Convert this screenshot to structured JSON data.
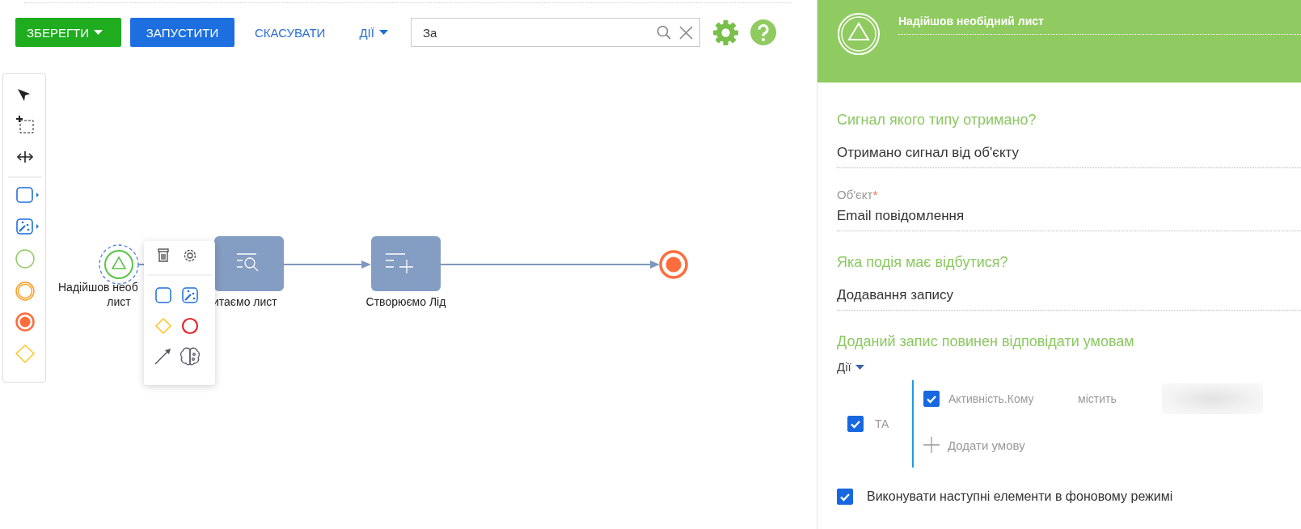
{
  "toolbar": {
    "buttons": [
      {
        "label": "ЗБЕРЕГТИ",
        "kind": "save"
      },
      {
        "label": "ЗАПУСТИТИ",
        "kind": "run"
      },
      {
        "label": "СКАСУВАТИ",
        "kind": "link"
      },
      {
        "label": "ДІЇ",
        "kind": "menu"
      }
    ],
    "search": {
      "value": "За"
    }
  },
  "diagram": {
    "nodes": [
      {
        "kind": "start",
        "label_lines": [
          "Надійшов необ",
          "лист"
        ],
        "selected": true
      },
      {
        "kind": "read",
        "label": "итаємо лист",
        "selected": false
      },
      {
        "kind": "create",
        "label": "Створюємо Лід",
        "selected": false
      },
      {
        "kind": "end",
        "selected": false
      }
    ]
  },
  "panel": {
    "title": "Надійшов необідний лист",
    "sections": [
      {
        "heading": "Сигнал якого типу отримано?",
        "fields": [
          {
            "value": "Отримано сигнал від об'єкту"
          },
          {
            "label": "Об'єкт",
            "required_mark": "*",
            "value": "Email повідомлення"
          }
        ]
      },
      {
        "heading": "Яка подія має відбутися?",
        "fields": [
          {
            "value": "Додавання запису"
          }
        ]
      },
      {
        "heading": "Доданий запис повинен відповідати умовам",
        "actions": "Дії",
        "group": {
          "operator": "ТА",
          "checked": true,
          "conditions": [
            {
              "checked": true,
              "column": "Активність.Кому",
              "comparison": "містить"
            }
          ],
          "add_label": "Додати умову"
        }
      }
    ],
    "footer": {
      "label": "Виконувати наступні елементи в фоновому режимі",
      "checked": true
    }
  }
}
